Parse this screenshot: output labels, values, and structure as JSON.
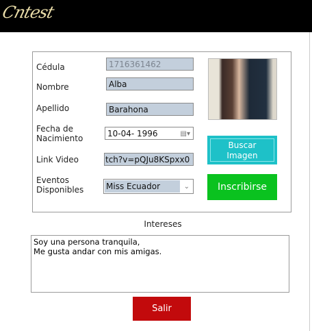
{
  "header": {
    "logo_text": "Cntest"
  },
  "form": {
    "cedula": {
      "label": "Cédula",
      "value": "1716361462"
    },
    "nombre": {
      "label": "Nombre",
      "value": "Alba"
    },
    "apellido": {
      "label": "Apellido",
      "value": "Barahona"
    },
    "fecha": {
      "label_line1": "Fecha de",
      "label_line2": "Nacimiento",
      "value": "10-04- 1996"
    },
    "link": {
      "label": "Link Video",
      "value": "tch?v=pQJu8KSpxx0"
    },
    "eventos": {
      "label_line1": "Eventos",
      "label_line2": "Disponibles",
      "value": "Miss Ecuador"
    }
  },
  "buttons": {
    "buscar_line1": "Buscar",
    "buscar_line2": "Imagen",
    "inscribirse": "Inscribirse",
    "salir": "Salir"
  },
  "intereses": {
    "label": "Intereses",
    "text": "Soy una persona tranquila,\nMe gusta andar con mis amigas."
  },
  "colors": {
    "buscar": "#1ec1c8",
    "inscribirse": "#0ac21f",
    "salir": "#c20a0c"
  }
}
